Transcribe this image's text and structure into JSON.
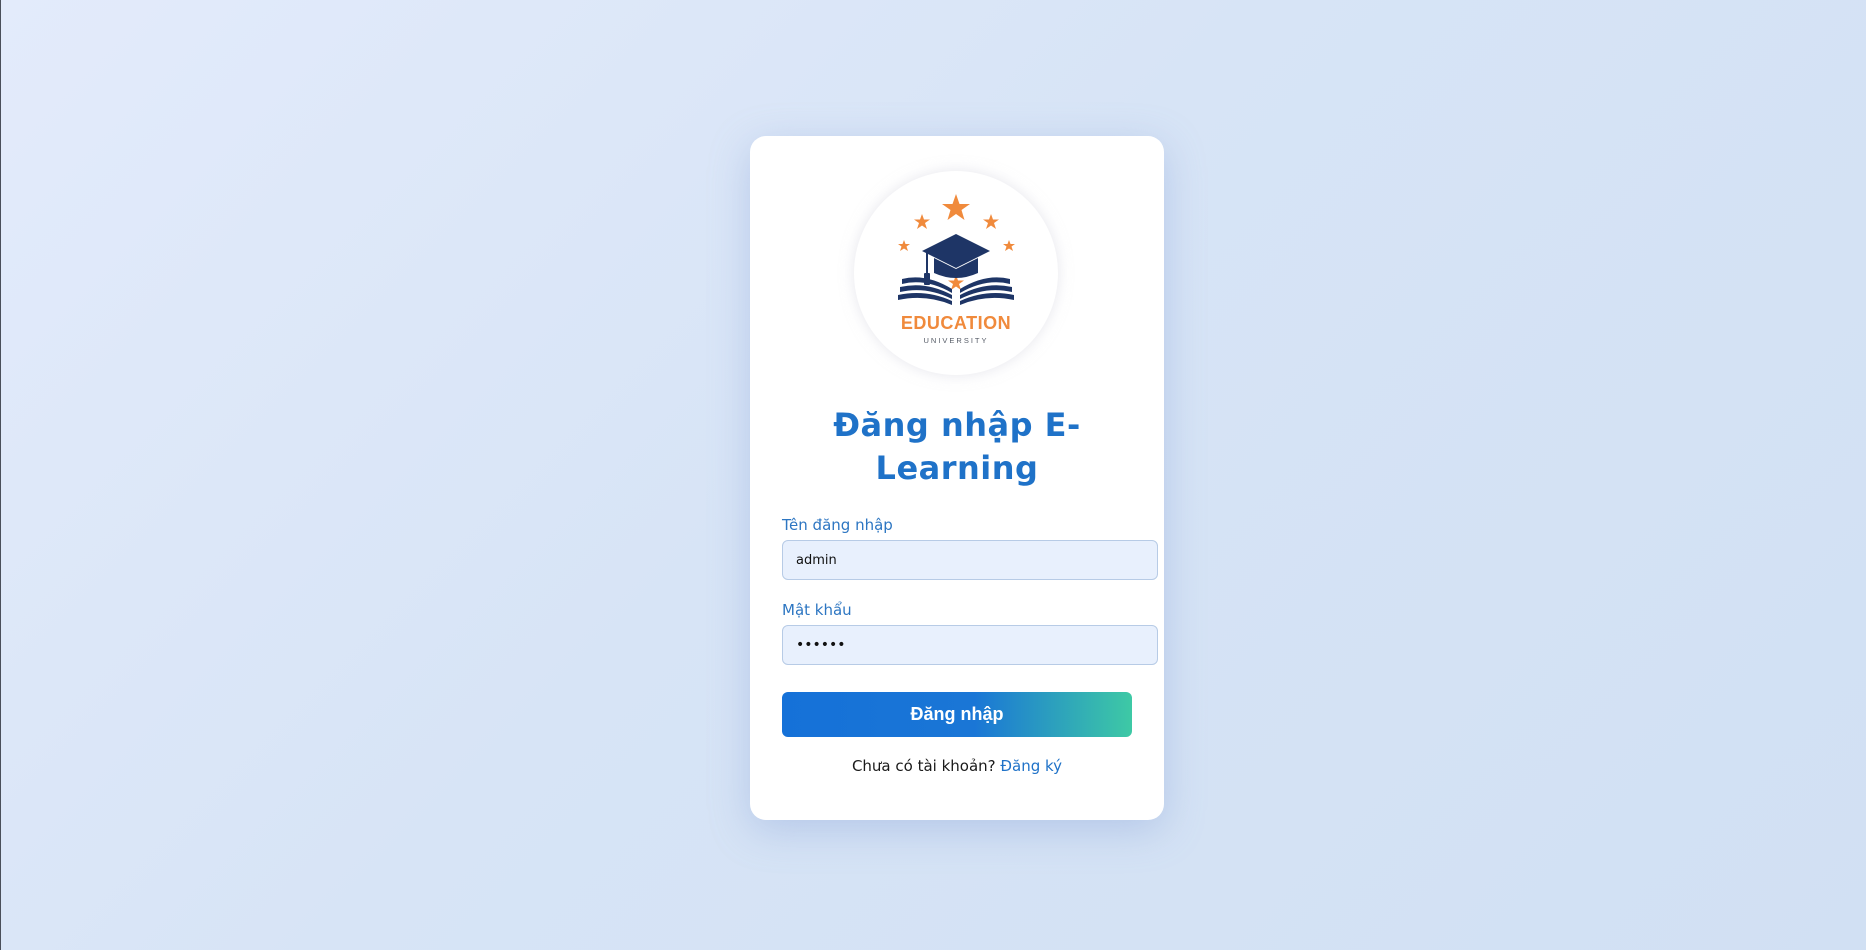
{
  "logo": {
    "icon": "education-university-logo",
    "brand_text": "EDUCATION",
    "sub_text": "UNIVERSITY",
    "colors": {
      "navy": "#1e3566",
      "orange": "#f08a3c"
    }
  },
  "login": {
    "title_line1": "Đăng nhập E-",
    "title_line2": "Learning",
    "username_label": "Tên đăng nhập",
    "username_value": "admin",
    "password_label": "Mật khẩu",
    "password_value": "••••••",
    "submit_label": "Đăng nhập",
    "signup_prompt": "Chưa có tài khoản?",
    "signup_link": "Đăng ký"
  },
  "colors": {
    "accent": "#1f72c8",
    "button_gradient_start": "#1571d8",
    "button_gradient_end": "#3ec9a5",
    "input_bg": "#e8f0fd"
  }
}
